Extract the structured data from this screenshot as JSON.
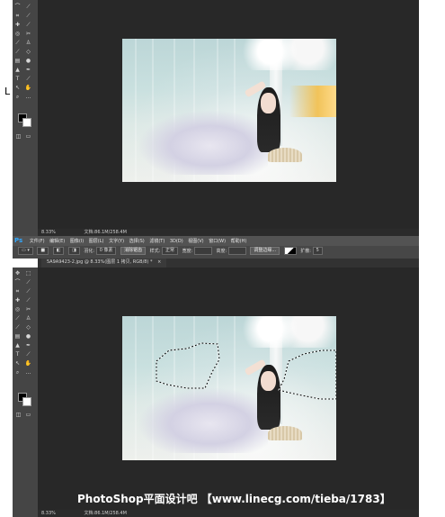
{
  "top_panel": {
    "status_zoom": "8.33%",
    "status_doc": "文档:86.1M/258.4M",
    "side_letter": "L"
  },
  "menubar": {
    "logo": "Ps",
    "items": [
      "文件(F)",
      "编辑(E)",
      "图像(I)",
      "图层(L)",
      "文字(Y)",
      "选择(S)",
      "滤镜(T)",
      "3D(D)",
      "视图(V)",
      "窗口(W)",
      "帮助(H)"
    ]
  },
  "optionsbar": {
    "feather_label": "羽化:",
    "feather_value": "0 像素",
    "antialias_label": "消除锯齿",
    "style_label": "样式:",
    "style_value": "正常",
    "width_label": "宽度:",
    "height_label": "高度:",
    "refine_button": "调整边缘...",
    "mode_label": "扩散:",
    "mode_value": "5"
  },
  "document_tab": {
    "title": "5A9A9423-2.jpg @ 8.33%(图层 1 拷贝, RGB/8) *",
    "close": "×"
  },
  "bottom_panel": {
    "status_zoom": "8.33%",
    "status_doc": "文档:86.1M/258.4M"
  },
  "watermark": {
    "text": "PhotoShop平面设计吧 【www.linecg.com/tieba/1783】"
  },
  "icons": {
    "tools": [
      "lasso-icon",
      "eyedropper-icon",
      "crop-icon",
      "healing-brush-icon",
      "brush-icon",
      "stamp-icon",
      "history-brush-icon",
      "eraser-icon",
      "gradient-icon",
      "blur-icon",
      "dodge-icon",
      "pen-icon",
      "text-icon",
      "path-select-icon",
      "shape-icon",
      "hand-icon",
      "zoom-icon",
      "more-icon"
    ]
  },
  "colors": {
    "ps_blue": "#31a8ff",
    "canvas_bg": "#282828",
    "panel_bg": "#454545"
  }
}
